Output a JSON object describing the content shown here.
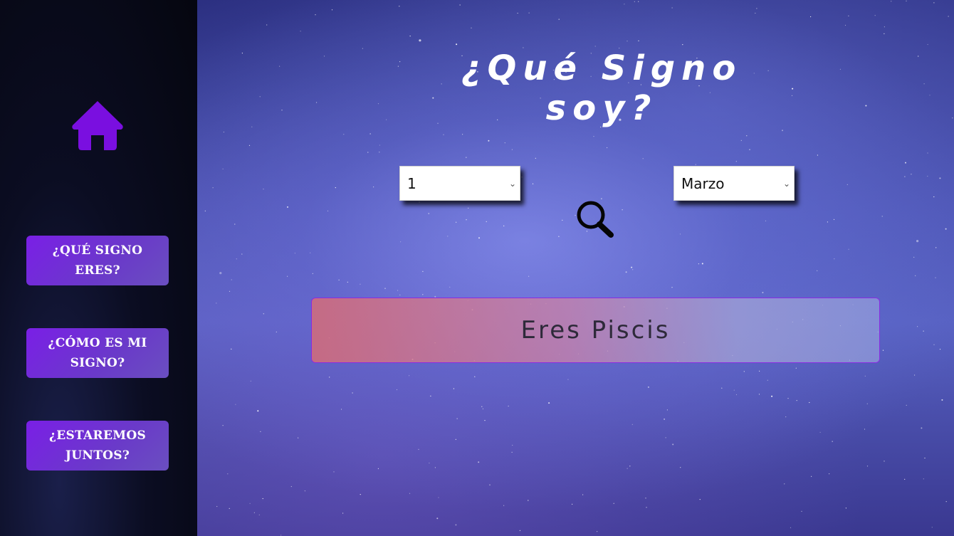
{
  "title": "¿Qué Signo soy?",
  "nav": {
    "home_icon": "home-icon",
    "items": [
      {
        "label": "¿QUÉ SIGNO ERES?"
      },
      {
        "label": "¿CÓMO ES MI SIGNO?"
      },
      {
        "label": "¿ESTAREMOS JUNTOS?"
      }
    ]
  },
  "form": {
    "day_value": "1",
    "month_value": "Marzo",
    "search_icon": "magnifier-icon"
  },
  "result": {
    "text": "Eres Piscis"
  },
  "colors": {
    "accent": "#7a1fe6",
    "result_border": "#8a2be2"
  }
}
